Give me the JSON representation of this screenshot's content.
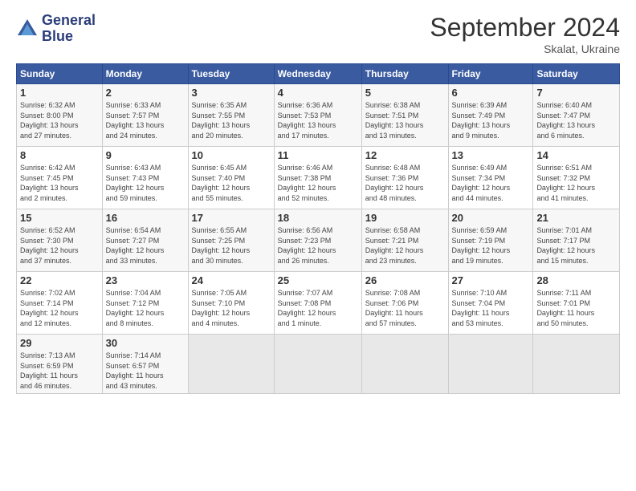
{
  "logo": {
    "line1": "General",
    "line2": "Blue"
  },
  "title": "September 2024",
  "subtitle": "Skalat, Ukraine",
  "days_header": [
    "Sunday",
    "Monday",
    "Tuesday",
    "Wednesday",
    "Thursday",
    "Friday",
    "Saturday"
  ],
  "weeks": [
    [
      {
        "num": "1",
        "info": "Sunrise: 6:32 AM\nSunset: 8:00 PM\nDaylight: 13 hours\nand 27 minutes."
      },
      {
        "num": "2",
        "info": "Sunrise: 6:33 AM\nSunset: 7:57 PM\nDaylight: 13 hours\nand 24 minutes."
      },
      {
        "num": "3",
        "info": "Sunrise: 6:35 AM\nSunset: 7:55 PM\nDaylight: 13 hours\nand 20 minutes."
      },
      {
        "num": "4",
        "info": "Sunrise: 6:36 AM\nSunset: 7:53 PM\nDaylight: 13 hours\nand 17 minutes."
      },
      {
        "num": "5",
        "info": "Sunrise: 6:38 AM\nSunset: 7:51 PM\nDaylight: 13 hours\nand 13 minutes."
      },
      {
        "num": "6",
        "info": "Sunrise: 6:39 AM\nSunset: 7:49 PM\nDaylight: 13 hours\nand 9 minutes."
      },
      {
        "num": "7",
        "info": "Sunrise: 6:40 AM\nSunset: 7:47 PM\nDaylight: 13 hours\nand 6 minutes."
      }
    ],
    [
      {
        "num": "8",
        "info": "Sunrise: 6:42 AM\nSunset: 7:45 PM\nDaylight: 13 hours\nand 2 minutes."
      },
      {
        "num": "9",
        "info": "Sunrise: 6:43 AM\nSunset: 7:43 PM\nDaylight: 12 hours\nand 59 minutes."
      },
      {
        "num": "10",
        "info": "Sunrise: 6:45 AM\nSunset: 7:40 PM\nDaylight: 12 hours\nand 55 minutes."
      },
      {
        "num": "11",
        "info": "Sunrise: 6:46 AM\nSunset: 7:38 PM\nDaylight: 12 hours\nand 52 minutes."
      },
      {
        "num": "12",
        "info": "Sunrise: 6:48 AM\nSunset: 7:36 PM\nDaylight: 12 hours\nand 48 minutes."
      },
      {
        "num": "13",
        "info": "Sunrise: 6:49 AM\nSunset: 7:34 PM\nDaylight: 12 hours\nand 44 minutes."
      },
      {
        "num": "14",
        "info": "Sunrise: 6:51 AM\nSunset: 7:32 PM\nDaylight: 12 hours\nand 41 minutes."
      }
    ],
    [
      {
        "num": "15",
        "info": "Sunrise: 6:52 AM\nSunset: 7:30 PM\nDaylight: 12 hours\nand 37 minutes."
      },
      {
        "num": "16",
        "info": "Sunrise: 6:54 AM\nSunset: 7:27 PM\nDaylight: 12 hours\nand 33 minutes."
      },
      {
        "num": "17",
        "info": "Sunrise: 6:55 AM\nSunset: 7:25 PM\nDaylight: 12 hours\nand 30 minutes."
      },
      {
        "num": "18",
        "info": "Sunrise: 6:56 AM\nSunset: 7:23 PM\nDaylight: 12 hours\nand 26 minutes."
      },
      {
        "num": "19",
        "info": "Sunrise: 6:58 AM\nSunset: 7:21 PM\nDaylight: 12 hours\nand 23 minutes."
      },
      {
        "num": "20",
        "info": "Sunrise: 6:59 AM\nSunset: 7:19 PM\nDaylight: 12 hours\nand 19 minutes."
      },
      {
        "num": "21",
        "info": "Sunrise: 7:01 AM\nSunset: 7:17 PM\nDaylight: 12 hours\nand 15 minutes."
      }
    ],
    [
      {
        "num": "22",
        "info": "Sunrise: 7:02 AM\nSunset: 7:14 PM\nDaylight: 12 hours\nand 12 minutes."
      },
      {
        "num": "23",
        "info": "Sunrise: 7:04 AM\nSunset: 7:12 PM\nDaylight: 12 hours\nand 8 minutes."
      },
      {
        "num": "24",
        "info": "Sunrise: 7:05 AM\nSunset: 7:10 PM\nDaylight: 12 hours\nand 4 minutes."
      },
      {
        "num": "25",
        "info": "Sunrise: 7:07 AM\nSunset: 7:08 PM\nDaylight: 12 hours\nand 1 minute."
      },
      {
        "num": "26",
        "info": "Sunrise: 7:08 AM\nSunset: 7:06 PM\nDaylight: 11 hours\nand 57 minutes."
      },
      {
        "num": "27",
        "info": "Sunrise: 7:10 AM\nSunset: 7:04 PM\nDaylight: 11 hours\nand 53 minutes."
      },
      {
        "num": "28",
        "info": "Sunrise: 7:11 AM\nSunset: 7:01 PM\nDaylight: 11 hours\nand 50 minutes."
      }
    ],
    [
      {
        "num": "29",
        "info": "Sunrise: 7:13 AM\nSunset: 6:59 PM\nDaylight: 11 hours\nand 46 minutes."
      },
      {
        "num": "30",
        "info": "Sunrise: 7:14 AM\nSunset: 6:57 PM\nDaylight: 11 hours\nand 43 minutes."
      },
      {
        "num": "",
        "info": ""
      },
      {
        "num": "",
        "info": ""
      },
      {
        "num": "",
        "info": ""
      },
      {
        "num": "",
        "info": ""
      },
      {
        "num": "",
        "info": ""
      }
    ]
  ]
}
